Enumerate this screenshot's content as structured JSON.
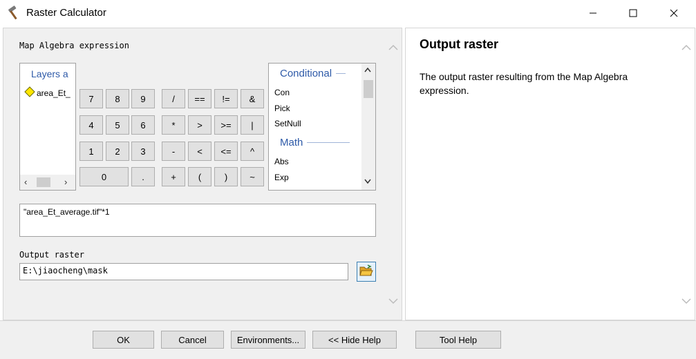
{
  "window": {
    "title": "Raster Calculator",
    "icon": "hammer-icon"
  },
  "left": {
    "expression_label": "Map Algebra expression",
    "layers": {
      "title": "Layers a",
      "items": [
        {
          "label": "area_Et_",
          "icon": "raster-layer-diamond-icon"
        }
      ]
    },
    "keypad": {
      "k7": "7",
      "k8": "8",
      "k9": "9",
      "div": "/",
      "eq": "==",
      "neq": "!=",
      "and": "&",
      "k4": "4",
      "k5": "5",
      "k6": "6",
      "mul": "*",
      "gt": ">",
      "gte": ">=",
      "or": "|",
      "k1": "1",
      "k2": "2",
      "k3": "3",
      "sub": "-",
      "lt": "<",
      "lte": "<=",
      "xor": "^",
      "k0": "0",
      "dot": ".",
      "add": "+",
      "lparen": "(",
      "rparen": ")",
      "not": "~"
    },
    "functions": {
      "groups": [
        {
          "header": "Conditional",
          "items": [
            "Con",
            "Pick",
            "SetNull"
          ]
        },
        {
          "header": "Math",
          "items": [
            "Abs",
            "Exp"
          ]
        }
      ]
    },
    "expression": "\"area_Et_average.tif\"*1",
    "output_label": "Output raster",
    "output_value": "E:\\jiaocheng\\mask"
  },
  "help": {
    "title": "Output raster",
    "body": "The output raster resulting from the Map Algebra expression."
  },
  "buttons": {
    "ok": "OK",
    "cancel": "Cancel",
    "environments": "Environments...",
    "hide_help": "<< Hide Help",
    "tool_help": "Tool Help"
  },
  "colors": {
    "accent_blue": "#2e5aa8",
    "folder_yellow": "#f5c542",
    "layer_diamond": "#ffe600"
  }
}
